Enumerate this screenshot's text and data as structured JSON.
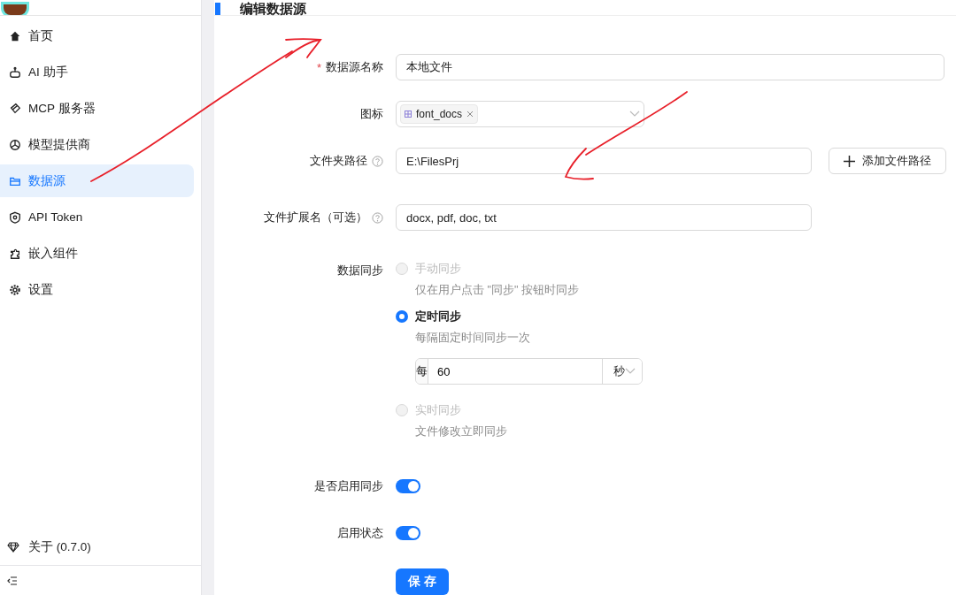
{
  "sidebar": {
    "items": [
      {
        "label": "首页",
        "selected": false
      },
      {
        "label": "AI 助手",
        "selected": false
      },
      {
        "label": "MCP 服务器",
        "selected": false
      },
      {
        "label": "模型提供商",
        "selected": false
      },
      {
        "label": "数据源",
        "selected": true
      },
      {
        "label": "API Token",
        "selected": false
      },
      {
        "label": "嵌入组件",
        "selected": false
      },
      {
        "label": "设置",
        "selected": false
      }
    ],
    "about": "关于 (0.7.0)"
  },
  "form": {
    "title": "编辑数据源",
    "name": {
      "label": "数据源名称",
      "required_mark": "*",
      "value": "本地文件"
    },
    "icon_select": {
      "label": "图标",
      "tag": "font_docs"
    },
    "folder_path": {
      "label": "文件夹路径",
      "value": "E:\\FilesPrj",
      "add_button": "添加文件路径"
    },
    "extensions": {
      "label": "文件扩展名（可选）",
      "value": "docx, pdf, doc, txt"
    },
    "sync": {
      "label": "数据同步",
      "options": [
        {
          "label": "手动同步",
          "description": "仅在用户点击 \"同步\" 按钮时同步",
          "selected": false,
          "disabled": true
        },
        {
          "label": "定时同步",
          "description": "每隔固定时间同步一次",
          "selected": true,
          "disabled": false,
          "interval": {
            "prefix": "每",
            "value": "60",
            "unit": "秒"
          }
        },
        {
          "label": "实时同步",
          "description": "文件修改立即同步",
          "selected": false,
          "disabled": true
        }
      ]
    },
    "sync_enabled": {
      "label": "是否启用同步",
      "on": true
    },
    "enabled": {
      "label": "启用状态",
      "on": true
    },
    "save_button": "保 存"
  }
}
